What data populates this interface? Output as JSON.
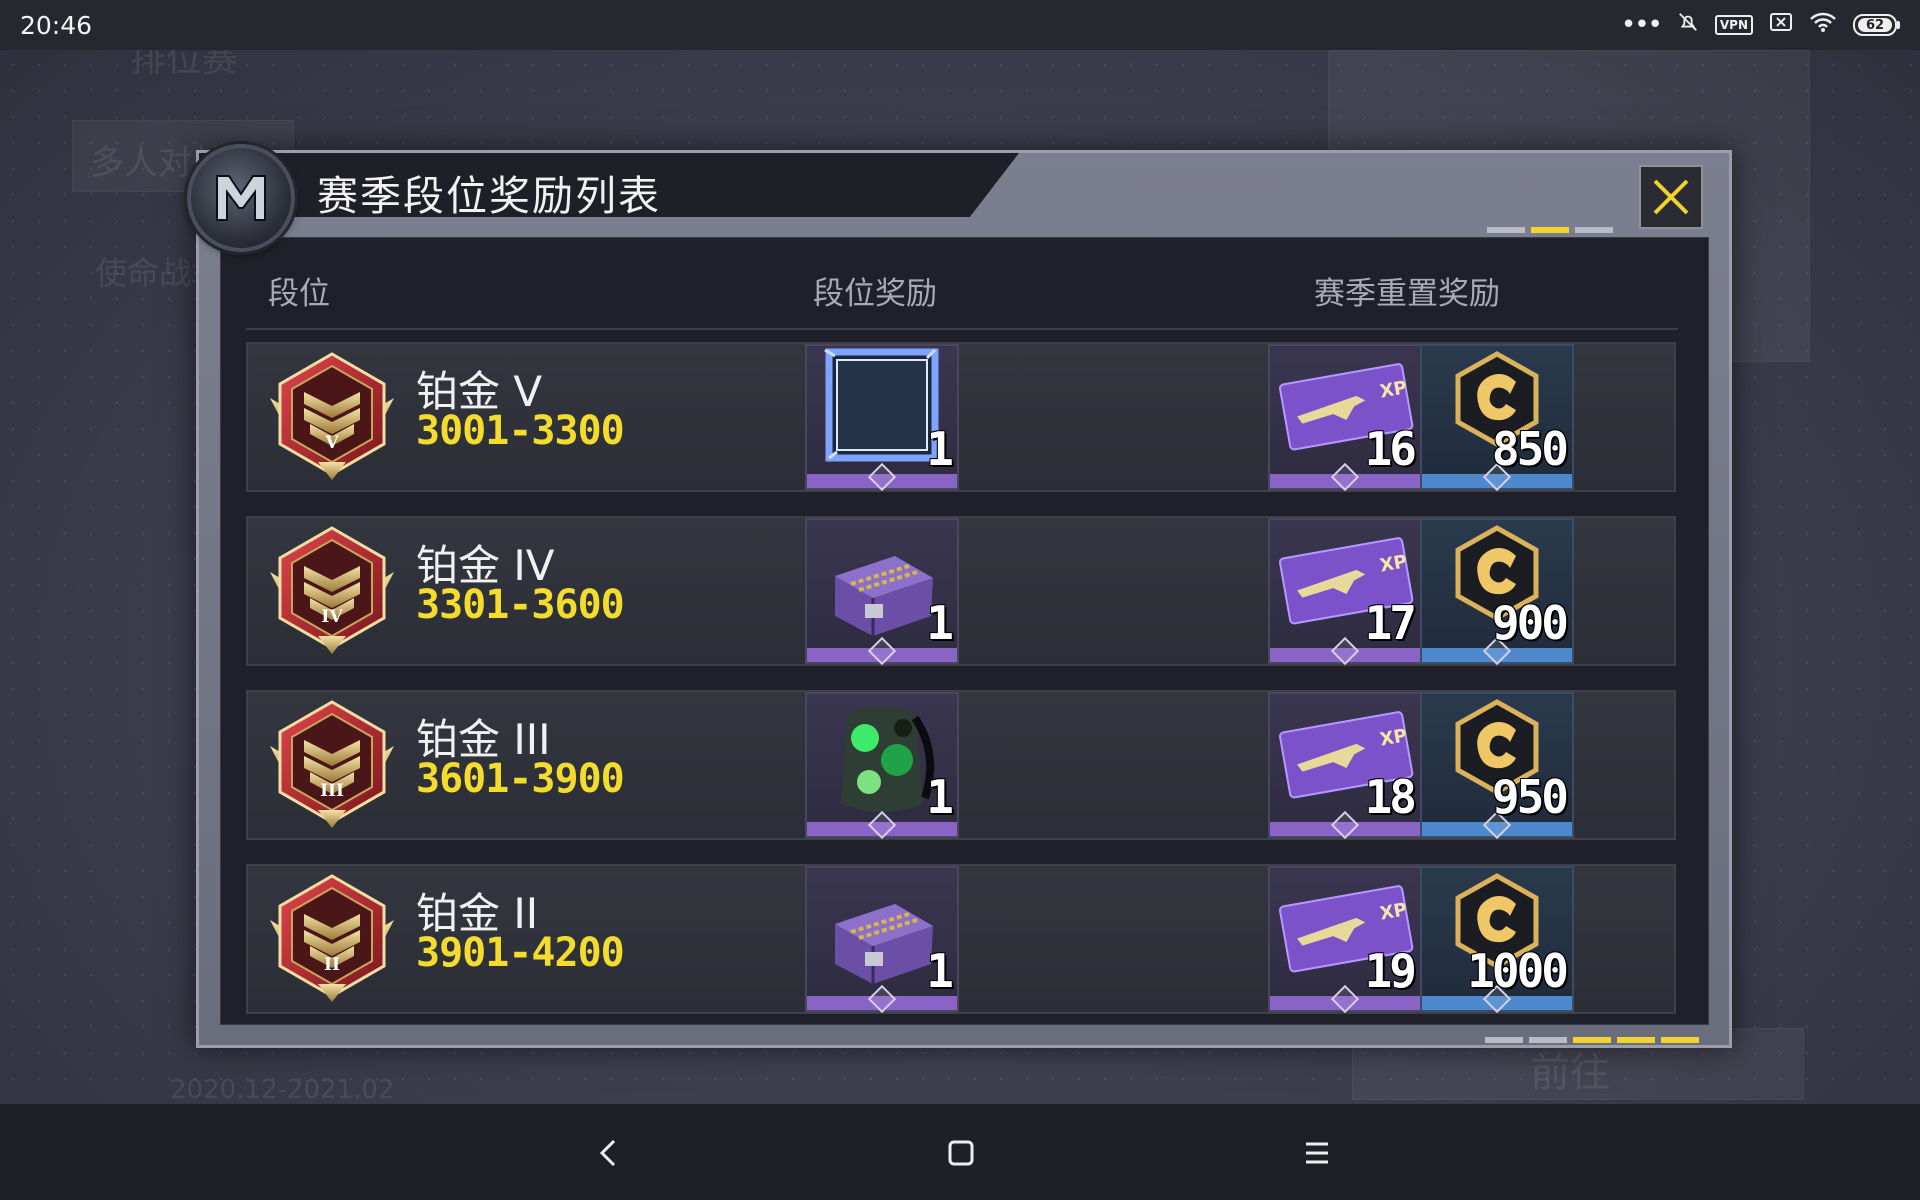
{
  "status_bar": {
    "time": "20:46",
    "icons": [
      "more-dots-icon",
      "mute-bell-icon",
      "vpn-icon",
      "sim-x-icon",
      "wifi-icon",
      "battery-icon"
    ],
    "vpn_label": "VPN",
    "battery_level": "62"
  },
  "dialog": {
    "title": "赛季段位奖励列表",
    "columns": {
      "rank": "段位",
      "rank_reward": "段位奖励",
      "season_reset_reward": "赛季重置奖励"
    },
    "accent_color": "#f4dc2c",
    "rows": [
      {
        "rank_name": "铂金 V",
        "emblem_numeral": "V",
        "range": "3001-3300",
        "rank_reward": {
          "item": "avatar-frame",
          "qty": "1"
        },
        "reset_xp": {
          "item": "xp-card",
          "qty": "16"
        },
        "reset_credits": {
          "item": "credit-coin",
          "qty": "850"
        }
      },
      {
        "rank_name": "铂金 IV",
        "emblem_numeral": "IV",
        "range": "3301-3600",
        "rank_reward": {
          "item": "supply-crate",
          "qty": "1"
        },
        "reset_xp": {
          "item": "xp-card",
          "qty": "17"
        },
        "reset_credits": {
          "item": "credit-coin",
          "qty": "900"
        }
      },
      {
        "rank_name": "铂金 III",
        "emblem_numeral": "III",
        "range": "3601-3900",
        "rank_reward": {
          "item": "camo-backpack",
          "qty": "1"
        },
        "reset_xp": {
          "item": "xp-card",
          "qty": "18"
        },
        "reset_credits": {
          "item": "credit-coin",
          "qty": "950"
        }
      },
      {
        "rank_name": "铂金 II",
        "emblem_numeral": "II",
        "range": "3901-4200",
        "rank_reward": {
          "item": "supply-crate",
          "qty": "1"
        },
        "reset_xp": {
          "item": "xp-card",
          "qty": "19"
        },
        "reset_credits": {
          "item": "credit-coin",
          "qty": "1000"
        }
      }
    ]
  },
  "background": {
    "ghost_labels": [
      "排位赛",
      "多人对战",
      "使命战场",
      "前往",
      "2020.12-2021.02"
    ]
  }
}
